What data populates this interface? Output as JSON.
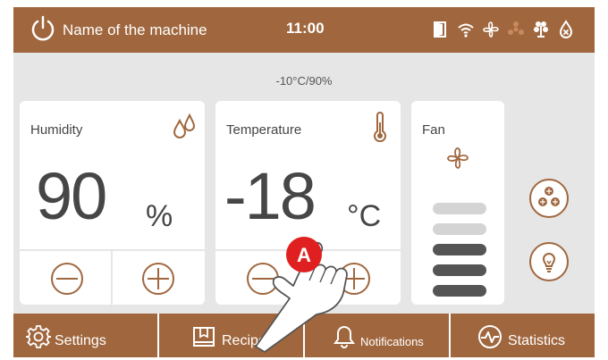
{
  "header": {
    "machine_name": "Name of the machine",
    "time": "11:00",
    "icons": [
      "power-icon",
      "door-icon",
      "wifi-icon",
      "fan-icon",
      "defrost-icon",
      "plant-icon",
      "drop-off-icon"
    ]
  },
  "setpoint": "-10°C/90%",
  "humidity": {
    "title": "Humidity",
    "value": "90",
    "unit": "%",
    "icon": "droplets-icon"
  },
  "temperature": {
    "title": "Temperature",
    "value": "-18",
    "unit": "°C",
    "icon": "thermometer-icon"
  },
  "fan": {
    "title": "Fan",
    "levels_total": 5,
    "levels_active": 3,
    "icon": "fan-icon"
  },
  "side_buttons": [
    "defrost-icon",
    "light-bulb-icon"
  ],
  "footer": {
    "settings": "Settings",
    "recipes": "Recipes",
    "notifications": "Notifications",
    "statistics": "Statistics"
  },
  "annotation": {
    "marker": "A"
  },
  "colors": {
    "brand": "#a0673e",
    "active_bar": "#555555",
    "inactive_bar": "#d4d4d4",
    "marker": "#e02020"
  }
}
